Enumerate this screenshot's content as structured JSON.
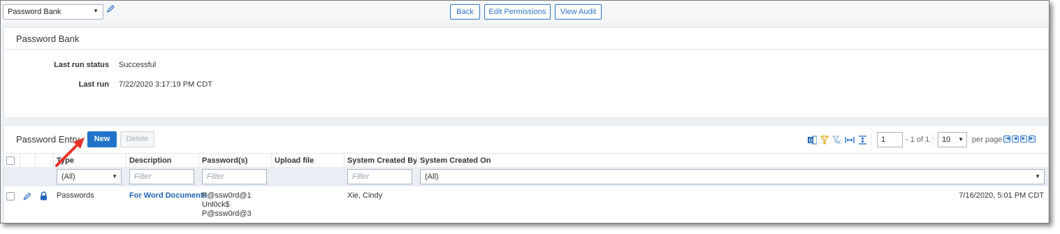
{
  "toolbar": {
    "view_selector": "Password Bank",
    "buttons": {
      "back": "Back",
      "edit_permissions": "Edit Permissions",
      "view_audit": "View Audit"
    }
  },
  "summary": {
    "title": "Password Bank",
    "fields": [
      {
        "label": "Last run status",
        "value": "Successful"
      },
      {
        "label": "Last run",
        "value": "7/22/2020 3:17:19 PM CDT"
      }
    ]
  },
  "entries": {
    "title": "Password Entry",
    "new_label": "New",
    "delete_label": "Delete",
    "pager": {
      "page": "1",
      "range_text": "- 1 of 1",
      "per_page_value": "10",
      "per_page_label": "per page"
    },
    "columns": [
      "Type",
      "Description",
      "Password(s)",
      "Upload file",
      "System Created By",
      "System Created On"
    ],
    "filters": {
      "type": "(All)",
      "description_placeholder": "Filter",
      "passwords_placeholder": "Filter",
      "created_by_placeholder": "Filter",
      "created_on": "(All)"
    },
    "rows": [
      {
        "type": "Passwords",
        "description": "For Word Documents",
        "passwords": [
          "P@ssw0rd@1",
          "Unl0ck$",
          "P@ssw0rd@3"
        ],
        "created_by": "Xie, Cindy",
        "created_on": "7/16/2020, 5:01 PM CDT"
      }
    ]
  },
  "colors": {
    "accent": "#1f73c9",
    "link": "#1f64b6",
    "annotation_arrow": "#e8322a"
  },
  "icons": [
    "pencil-icon",
    "outlook-icon",
    "filter-icon",
    "clear-filter-icon",
    "column-width-icon",
    "row-height-icon",
    "lock-icon"
  ]
}
